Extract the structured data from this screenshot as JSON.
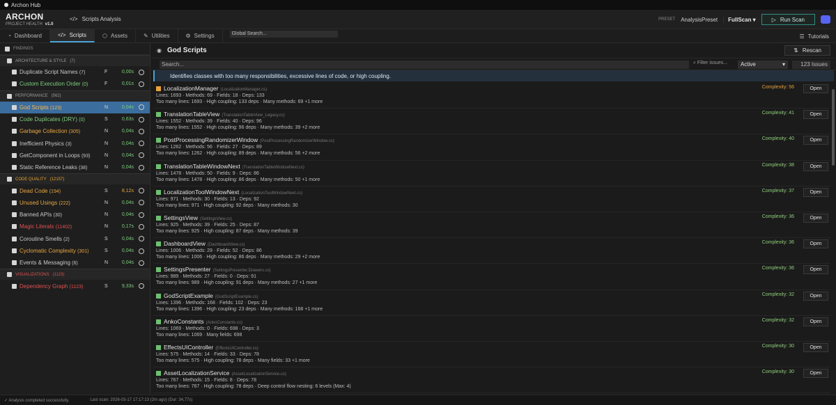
{
  "window_title": "Archon Hub",
  "brand": {
    "name": "ARCHON",
    "subtitle": "PROJECT HEALTH",
    "version": "v1.0"
  },
  "header": {
    "page_title": "Scripts Analysis",
    "preset_label": "PRESET",
    "preset_value": "AnalysisPreset",
    "scan_mode": "FullScan",
    "run_label": "Run Scan"
  },
  "tabs": [
    {
      "label": "Dashboard",
      "icon": "gauge-icon"
    },
    {
      "label": "Scripts",
      "icon": "code-icon"
    },
    {
      "label": "Assets",
      "icon": "cube-icon"
    },
    {
      "label": "Utilities",
      "icon": "wrench-icon"
    },
    {
      "label": "Settings",
      "icon": "gear-icon"
    }
  ],
  "global_search_placeholder": "Global Search...",
  "tutorials_label": "Tutorials",
  "sidebar": {
    "findings_label": "FINDINGS",
    "categories": [
      {
        "label": "ARCHITECTURE & STYLE",
        "count": "(7)",
        "color": "#9a9a9a",
        "items": [
          {
            "name": "Duplicate Script Names",
            "count": "(7)",
            "sev": "F",
            "time": "0,00s",
            "color": "#c8c8c8",
            "time_color": "#7fcf7f"
          },
          {
            "name": "Custom Execution Order",
            "count": "(0)",
            "sev": "F",
            "time": "0,01s",
            "color": "#7fcf7f",
            "time_color": "#7fcf7f"
          }
        ]
      },
      {
        "label": "PERFORMANCE",
        "count": "(562)",
        "color": "#9a9a9a",
        "items": [
          {
            "name": "God Scripts",
            "count": "(123)",
            "sev": "N",
            "time": "0,04s",
            "color": "#f0a030",
            "time_color": "#7fcf7f",
            "selected": true
          },
          {
            "name": "Code Duplicates (DRY)",
            "count": "(0)",
            "sev": "S",
            "time": "0,63s",
            "color": "#7fcf7f",
            "time_color": "#7fcf7f"
          },
          {
            "name": "Garbage Collection",
            "count": "(305)",
            "sev": "N",
            "time": "0,04s",
            "color": "#e8a640",
            "time_color": "#7fcf7f"
          },
          {
            "name": "Inefficient Physics",
            "count": "(3)",
            "sev": "N",
            "time": "0,04s",
            "color": "#c8c8c8",
            "time_color": "#7fcf7f"
          },
          {
            "name": "GetComponent in Loops",
            "count": "(93)",
            "sev": "N",
            "time": "0,04s",
            "color": "#c8c8c8",
            "time_color": "#7fcf7f"
          },
          {
            "name": "Static Reference Leaks",
            "count": "(38)",
            "sev": "N",
            "time": "0,04s",
            "color": "#c8c8c8",
            "time_color": "#7fcf7f"
          }
        ]
      },
      {
        "label": "CODE QUALITY",
        "count": "(12157)",
        "color": "#e6a030",
        "items": [
          {
            "name": "Dead Code",
            "count": "(194)",
            "sev": "S",
            "time": "8,12s",
            "color": "#e8a640",
            "time_color": "#e8a640"
          },
          {
            "name": "Unused Usings",
            "count": "(222)",
            "sev": "N",
            "time": "0,04s",
            "color": "#e8a640",
            "time_color": "#7fcf7f"
          },
          {
            "name": "Banned APIs",
            "count": "(30)",
            "sev": "N",
            "time": "0,04s",
            "color": "#c8c8c8",
            "time_color": "#7fcf7f"
          },
          {
            "name": "Magic Literals",
            "count": "(11402)",
            "sev": "N",
            "time": "0,17s",
            "color": "#e05050",
            "time_color": "#7fcf7f"
          },
          {
            "name": "Coroutine Smells",
            "count": "(2)",
            "sev": "S",
            "time": "0,04s",
            "color": "#c8c8c8",
            "time_color": "#7fcf7f"
          },
          {
            "name": "Cyclomatic Complexity",
            "count": "(301)",
            "sev": "S",
            "time": "0,04s",
            "color": "#e8a640",
            "time_color": "#7fcf7f"
          },
          {
            "name": "Events & Messaging",
            "count": "(6)",
            "sev": "N",
            "time": "0,04s",
            "color": "#c8c8c8",
            "time_color": "#7fcf7f"
          }
        ]
      },
      {
        "label": "VISUALIZATIONS",
        "count": "(1123)",
        "color": "#e05050",
        "items": [
          {
            "name": "Dependency Graph",
            "count": "(1123)",
            "sev": "S",
            "time": "9,33s",
            "color": "#e05050",
            "time_color": "#7fcf7f"
          }
        ]
      }
    ]
  },
  "main": {
    "title": "God Scripts",
    "rescan_label": "Rescan",
    "search_placeholder": "Search...",
    "filter_label": "Filter issues...",
    "filter_value": "Active",
    "issue_count": "123 Issues",
    "description": "Identifies classes with too many responsibilities, excessive lines of code, or high coupling.",
    "open_label": "Open",
    "issues": [
      {
        "name": "LocalizationManager",
        "file": "(LocalizationManager.cs)",
        "complexity": "Complexity: 56",
        "warn": true,
        "line1": "Lines: 1693  ·  Methods: 69  ·  Fields: 18  ·  Deps: 133",
        "line2": "Too many lines: 1693  ·  High coupling: 133 deps  ·  Many methods: 69  +1 more"
      },
      {
        "name": "TranslationTableView",
        "file": "(TranslationTableView_Legacy.cs)",
        "complexity": "Complexity: 41",
        "line1": "Lines: 1552  ·  Methods: 39  ·  Fields: 40  ·  Deps: 96",
        "line2": "Too many lines: 1552  ·  High coupling: 96 deps  ·  Many methods: 39  +2 more"
      },
      {
        "name": "PostProcessingRandomizerWindow",
        "file": "(PostProcessingRandomizerWindow.cs)",
        "complexity": "Complexity: 40",
        "line1": "Lines: 1262  ·  Methods: 56  ·  Fields: 27  ·  Deps: 89",
        "line2": "Too many lines: 1262  ·  High coupling: 89 deps  ·  Many methods: 56  +2 more"
      },
      {
        "name": "TranslationTableWindowNext",
        "file": "(TranslationTableWindowNext.cs)",
        "complexity": "Complexity: 38",
        "line1": "Lines: 1478  ·  Methods: 50  ·  Fields: 9  ·  Deps: 86",
        "line2": "Too many lines: 1478  ·  High coupling: 86 deps  ·  Many methods: 50  +1 more"
      },
      {
        "name": "LocalizationToolWindowNext",
        "file": "(LocalizationToolWindowNext.cs)",
        "complexity": "Complexity: 37",
        "line1": "Lines: 971  ·  Methods: 30  ·  Fields: 13  ·  Deps: 92",
        "line2": "Too many lines: 971  ·  High coupling: 92 deps  ·  Many methods: 30"
      },
      {
        "name": "SettingsView",
        "file": "(SettingsView.cs)",
        "complexity": "Complexity: 36",
        "line1": "Lines: 925  ·  Methods: 39  ·  Fields: 25  ·  Deps: 87",
        "line2": "Too many lines: 925  ·  High coupling: 87 deps  ·  Many methods: 39"
      },
      {
        "name": "DashboardView",
        "file": "(DashboardView.cs)",
        "complexity": "Complexity: 36",
        "line1": "Lines: 1006  ·  Methods: 29  ·  Fields: 52  ·  Deps: 86",
        "line2": "Too many lines: 1006  ·  High coupling: 86 deps  ·  Many methods: 29  +2 more"
      },
      {
        "name": "SettingsPresenter",
        "file": "(SettingsPresenter.Drawers.cs)",
        "complexity": "Complexity: 36",
        "line1": "Lines: 989  ·  Methods: 27  ·  Fields: 0  ·  Deps: 91",
        "line2": "Too many lines: 989  ·  High coupling: 91 deps  ·  Many methods: 27  +1 more"
      },
      {
        "name": "GodScriptExample",
        "file": "(GodScriptExample.cs)",
        "complexity": "Complexity: 32",
        "line1": "Lines: 1396  ·  Methods: 168  ·  Fields: 102  ·  Deps: 23",
        "line2": "Too many lines: 1396  ·  High coupling: 23 deps  ·  Many methods: 168  +1 more"
      },
      {
        "name": "AnkoConstants",
        "file": "(AnkoConstants.cs)",
        "complexity": "Complexity: 32",
        "line1": "Lines: 1069  ·  Methods: 0  ·  Fields: 698  ·  Deps: 3",
        "line2": "Too many lines: 1069  ·  Many fields: 698"
      },
      {
        "name": "EffectsUIController",
        "file": "(EffectsUIController.cs)",
        "complexity": "Complexity: 30",
        "line1": "Lines: 575  ·  Methods: 14  ·  Fields: 33  ·  Deps: 78",
        "line2": "Too many lines: 575  ·  High coupling: 78 deps  ·  Many fields: 33  +1 more"
      },
      {
        "name": "AssetLocalizationService",
        "file": "(AssetLocalizationService.cs)",
        "complexity": "Complexity: 30",
        "line1": "Lines: 767  ·  Methods: 15  ·  Fields: 8  ·  Deps: 78",
        "line2": "Too many lines: 767  ·  High coupling: 78 deps  ·  Deep control flow nesting: 6 levels (Max: 4)"
      }
    ]
  },
  "status": {
    "left": "Analysis completed successfully.",
    "right": "Last scan: 2026-03-17 17:17:13 (2m ago) (Dur: 34,77s)"
  }
}
